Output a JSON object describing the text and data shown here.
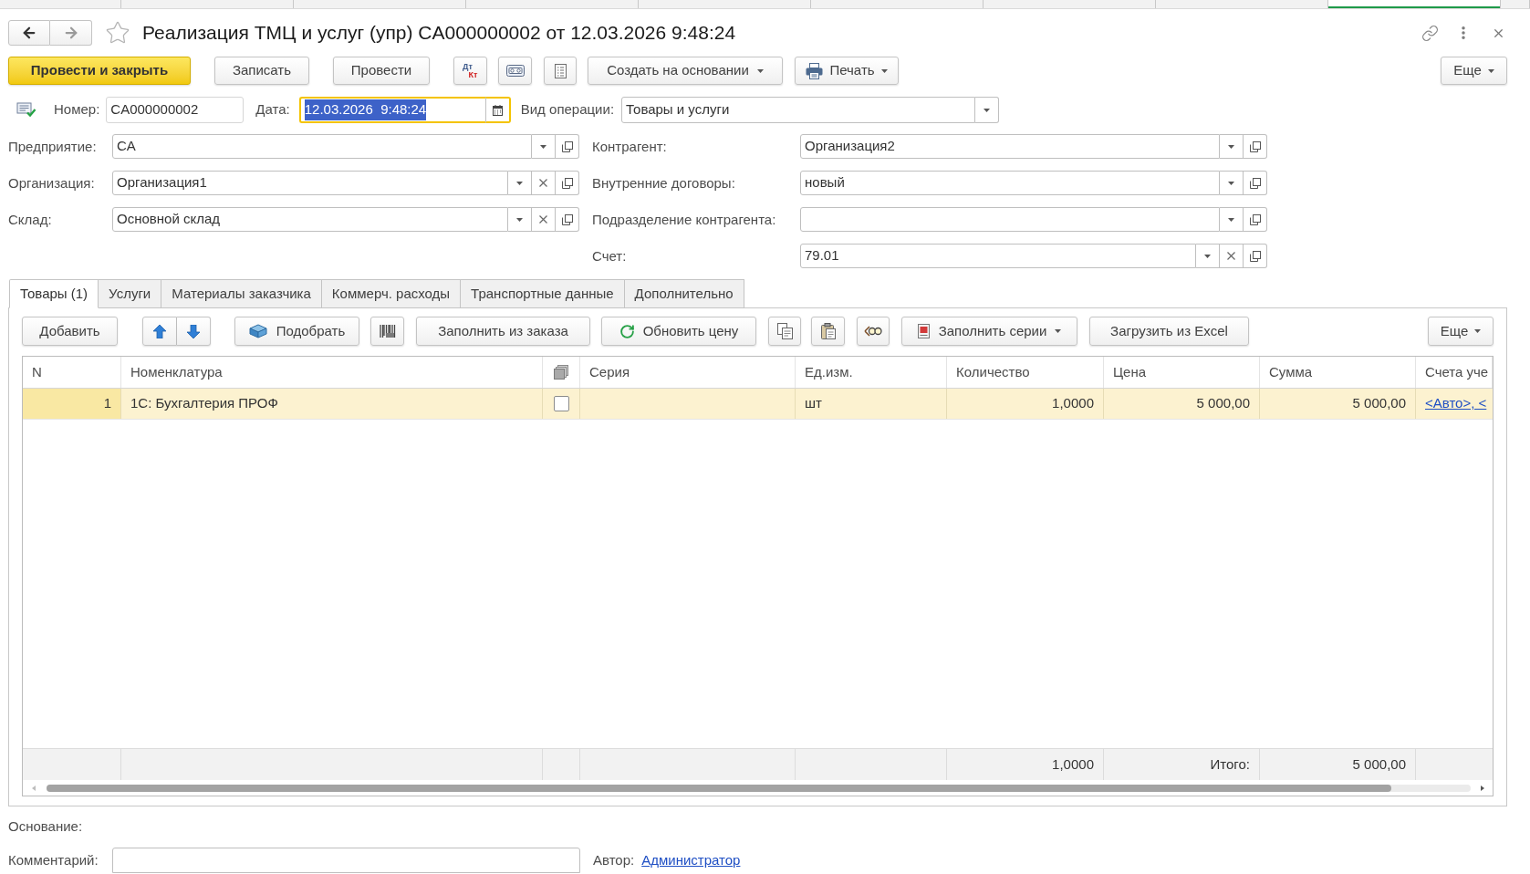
{
  "window_tabs": [
    {
      "selected": false
    },
    {
      "selected": false
    },
    {
      "selected": false
    },
    {
      "selected": false
    },
    {
      "selected": false
    },
    {
      "selected": false
    },
    {
      "selected": false
    },
    {
      "selected": false
    },
    {
      "selected": true
    },
    {
      "selected": false
    }
  ],
  "navigation": {
    "back": {
      "disabled": false
    },
    "forward": {
      "disabled": true
    }
  },
  "favorite": false,
  "title": "Реализация ТМЦ и услуг (упр) CA000000002 от 12.03.2026 9:48:24",
  "command_bar": {
    "post_and_close": "Провести и закрыть",
    "save": "Записать",
    "post": "Провести",
    "debit": "Дт",
    "credit": "Кт",
    "create_based_on": "Создать на основании",
    "print": "Печать",
    "more": "Еще"
  },
  "header": {
    "number": {
      "label": "Номер:",
      "value": "CA000000002"
    },
    "date": {
      "label": "Дата:",
      "value": "12.03.2026  9:48:24",
      "focused": true
    },
    "operation": {
      "label": "Вид операции:",
      "value": "Товары и услуги"
    }
  },
  "left_fields": [
    {
      "label": "Предприятие:",
      "value": "CA",
      "clearable": false
    },
    {
      "label": "Организация:",
      "value": "Организация1",
      "clearable": true
    },
    {
      "label": "Склад:",
      "value": "Основной склад",
      "clearable": true
    }
  ],
  "right_fields": [
    {
      "label": "Контрагент:",
      "value": "Организация2",
      "clearable": false
    },
    {
      "label": "Внутренние договоры:",
      "value": "новый",
      "clearable": false
    },
    {
      "label": "Подразделение контрагента:",
      "clearable": false
    },
    {
      "label": "Счет:",
      "value": "79.01",
      "clearable": true
    }
  ],
  "tabs": [
    {
      "label": "Товары (1)",
      "selected": true
    },
    {
      "label": "Услуги",
      "selected": false
    },
    {
      "label": "Материалы заказчика",
      "selected": false
    },
    {
      "label": "Коммерч. расходы",
      "selected": false
    },
    {
      "label": "Транспортные данные",
      "selected": false
    },
    {
      "label": "Дополнительно",
      "selected": false
    }
  ],
  "table_toolbar": {
    "add": "Добавить",
    "pick": "Подобрать",
    "fill_from_order": "Заполнить из заказа",
    "update_price": "Обновить цену",
    "fill_series": "Заполнить серии",
    "load_from_excel": "Загрузить из Excel",
    "more": "Еще"
  },
  "table": {
    "columns": [
      {
        "kind": "text",
        "label": "N"
      },
      {
        "kind": "text",
        "label": "Номенклатура"
      },
      {
        "kind": "flag"
      },
      {
        "kind": "text",
        "label": "Серия"
      },
      {
        "kind": "text",
        "label": "Ед.изм."
      },
      {
        "kind": "text",
        "label": "Количество"
      },
      {
        "kind": "text",
        "label": "Цена"
      },
      {
        "kind": "text",
        "label": "Сумма"
      },
      {
        "kind": "text",
        "label": "Счета уче"
      }
    ],
    "rows": [
      {
        "selected": true,
        "n": "1",
        "item": "1С: Бухгалтерия ПРОФ",
        "checked": false,
        "unit": "шт",
        "quantity": "1,0000",
        "price": "5 000,00",
        "sum": "5 000,00",
        "accounts": "<Авто>, <"
      }
    ],
    "totals": {
      "quantity": "1,0000",
      "label": "Итого:",
      "sum": "5 000,00"
    }
  },
  "basis": {
    "label": "Основание:"
  },
  "comment": {
    "label": "Комментарий:"
  },
  "author": {
    "label": "Автор:",
    "value": "Администратор"
  }
}
